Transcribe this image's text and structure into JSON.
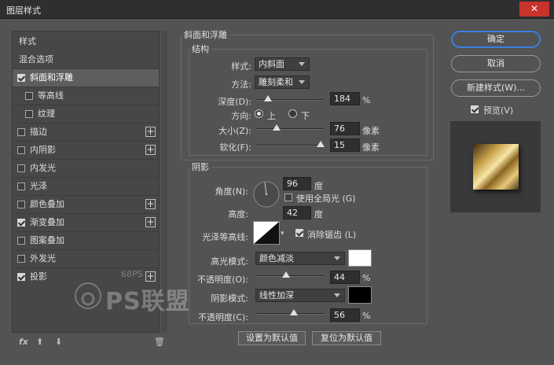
{
  "window": {
    "title": "图层样式",
    "close_glyph": "✕"
  },
  "left_panel": {
    "items": [
      {
        "label": "样式",
        "checkbox": false,
        "checked": false,
        "plus": false,
        "indent": false
      },
      {
        "label": "混合选项",
        "checkbox": false,
        "checked": false,
        "plus": false,
        "indent": false
      },
      {
        "label": "斜面和浮雕",
        "checkbox": true,
        "checked": true,
        "plus": false,
        "indent": false,
        "selected": true
      },
      {
        "label": "等高线",
        "checkbox": true,
        "checked": false,
        "plus": false,
        "indent": true
      },
      {
        "label": "纹理",
        "checkbox": true,
        "checked": false,
        "plus": false,
        "indent": true
      },
      {
        "label": "描边",
        "checkbox": true,
        "checked": false,
        "plus": true,
        "indent": false
      },
      {
        "label": "内阴影",
        "checkbox": true,
        "checked": false,
        "plus": true,
        "indent": false
      },
      {
        "label": "内发光",
        "checkbox": true,
        "checked": false,
        "plus": false,
        "indent": false
      },
      {
        "label": "光泽",
        "checkbox": true,
        "checked": false,
        "plus": false,
        "indent": false
      },
      {
        "label": "颜色叠加",
        "checkbox": true,
        "checked": false,
        "plus": true,
        "indent": false
      },
      {
        "label": "渐变叠加",
        "checkbox": true,
        "checked": true,
        "plus": true,
        "indent": false
      },
      {
        "label": "图案叠加",
        "checkbox": true,
        "checked": false,
        "plus": false,
        "indent": false
      },
      {
        "label": "外发光",
        "checkbox": true,
        "checked": false,
        "plus": false,
        "indent": false
      },
      {
        "label": "投影",
        "checkbox": true,
        "checked": true,
        "plus": true,
        "indent": false
      }
    ],
    "footer": {
      "fx": "fx",
      "up": "⬆",
      "down": "⬇",
      "trash": "🗑"
    }
  },
  "bevel": {
    "group_title": "斜面和浮雕",
    "structure_title": "结构",
    "style_label": "样式:",
    "style_value": "内斜面",
    "technique_label": "方法:",
    "technique_value": "雕刻柔和",
    "depth_label": "深度(D):",
    "depth_value": "184",
    "depth_unit": "%",
    "depth_level": 0.18,
    "direction_label": "方向:",
    "dir_up": "上",
    "dir_down": "下",
    "size_label": "大小(Z):",
    "size_value": "76",
    "size_unit": "像素",
    "size_level": 0.3,
    "soften_label": "软化(F):",
    "soften_value": "15",
    "soften_unit": "像素",
    "soften_level": 0.95
  },
  "shading": {
    "title": "阴影",
    "angle_label": "角度(N):",
    "angle_value": "96",
    "angle_unit": "度",
    "global_light_label": "使用全局光 (G)",
    "altitude_label": "高度:",
    "altitude_value": "42",
    "altitude_unit": "度",
    "gloss_label": "光泽等高线:",
    "antialias_label": "消除锯齿 (L)",
    "highlight_label": "高光模式:",
    "highlight_mode": "颜色减淡",
    "highlight_color": "#ffffff",
    "hl_opacity_label": "不透明度(O):",
    "hl_opacity_value": "44",
    "hl_opacity_unit": "%",
    "hl_opacity_level": 0.44,
    "shadow_label": "阴影模式:",
    "shadow_mode": "线性加深",
    "shadow_color": "#000000",
    "sh_opacity_label": "不透明度(C):",
    "sh_opacity_value": "56",
    "sh_opacity_unit": "%",
    "sh_opacity_level": 0.56
  },
  "bottom_buttons": {
    "set_default": "设置为默认值",
    "reset_default": "复位为默认值"
  },
  "right": {
    "ok": "确定",
    "cancel": "取消",
    "new_style": "新建样式(W)...",
    "preview_label": "预览(V)"
  },
  "watermark": {
    "site": "68PS",
    "brand": "PS联盟"
  }
}
